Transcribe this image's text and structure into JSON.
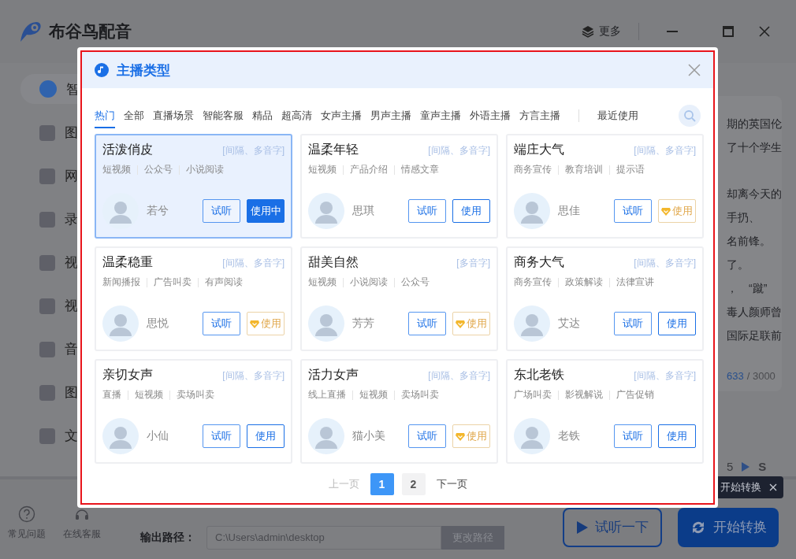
{
  "app": {
    "title": "布谷鸟配音",
    "more": "更多"
  },
  "sidebar": {
    "items": [
      {
        "label": "智",
        "selected": true
      },
      {
        "label": "图",
        "selected": false
      },
      {
        "label": "网",
        "selected": false
      },
      {
        "label": "录",
        "selected": false
      },
      {
        "label": "视",
        "selected": false
      },
      {
        "label": "视",
        "selected": false
      },
      {
        "label": "音",
        "selected": false
      },
      {
        "label": "图",
        "selected": false
      },
      {
        "label": "文",
        "selected": false
      }
    ]
  },
  "editor": {
    "paragraphs": [
      [
        "期的英国伦",
        "了十个学生"
      ],
      [
        "却离今天的",
        "手扔、",
        "名前锋。",
        "了。",
        "，　“蹴”",
        "毒人颜师曾",
        "国际足联前"
      ]
    ],
    "count": "633",
    "limit": "/ 3000",
    "toolbar": [
      "5",
      "S"
    ]
  },
  "footer": {
    "links": [
      "常见问题",
      "在线客服"
    ],
    "output_label": "输出路径：",
    "output_path": "C:\\Users\\admin\\desktop",
    "change_path": "更改路径",
    "preview": "试听一下",
    "start": "开始转换",
    "tooltip": "开始转换"
  },
  "dialog": {
    "title": "主播类型",
    "tabs": [
      {
        "label": "热门",
        "selected": true
      },
      {
        "label": "全部",
        "selected": false
      },
      {
        "label": "直播场景",
        "selected": false
      },
      {
        "label": "智能客服",
        "selected": false
      },
      {
        "label": "精品",
        "selected": false
      },
      {
        "label": "超高清",
        "selected": false
      },
      {
        "label": "女声主播",
        "selected": false
      },
      {
        "label": "男声主播",
        "selected": false
      },
      {
        "label": "童声主播",
        "selected": false
      },
      {
        "label": "外语主播",
        "selected": false
      },
      {
        "label": "方言主播",
        "selected": false
      }
    ],
    "recent": "最近使用",
    "cards": [
      {
        "title": "活泼俏皮",
        "badge": "[间隔、多音字]",
        "tags": [
          "短视频",
          "公众号",
          "小说阅读"
        ],
        "name": "若兮",
        "listen": "试听",
        "use": {
          "label": "使用中",
          "kind": "active"
        },
        "selected": true
      },
      {
        "title": "温柔年轻",
        "badge": "[间隔、多音字]",
        "tags": [
          "短视频",
          "产品介绍",
          "情感文章"
        ],
        "name": "思琪",
        "listen": "试听",
        "use": {
          "label": "使用",
          "kind": "normal"
        },
        "selected": false
      },
      {
        "title": "端庄大气",
        "badge": "[间隔、多音字]",
        "tags": [
          "商务宣传",
          "教育培训",
          "提示语"
        ],
        "name": "思佳",
        "listen": "试听",
        "use": {
          "label": "使用",
          "kind": "vip"
        },
        "selected": false
      },
      {
        "title": "温柔稳重",
        "badge": "[间隔、多音字]",
        "tags": [
          "新闻播报",
          "广告叫卖",
          "有声阅读"
        ],
        "name": "思悦",
        "listen": "试听",
        "use": {
          "label": "使用",
          "kind": "vip"
        },
        "selected": false
      },
      {
        "title": "甜美自然",
        "badge": "[多音字]",
        "tags": [
          "短视频",
          "小说阅读",
          "公众号"
        ],
        "name": "芳芳",
        "listen": "试听",
        "use": {
          "label": "使用",
          "kind": "vip"
        },
        "selected": false
      },
      {
        "title": "商务大气",
        "badge": "[间隔、多音字]",
        "tags": [
          "商务宣传",
          "政策解读",
          "法律宣讲"
        ],
        "name": "艾达",
        "listen": "试听",
        "use": {
          "label": "使用",
          "kind": "normal"
        },
        "selected": false
      },
      {
        "title": "亲切女声",
        "badge": "[间隔、多音字]",
        "tags": [
          "直播",
          "短视频",
          "卖场叫卖"
        ],
        "name": "小仙",
        "listen": "试听",
        "use": {
          "label": "使用",
          "kind": "normal"
        },
        "selected": false
      },
      {
        "title": "活力女声",
        "badge": "[间隔、多音字]",
        "tags": [
          "线上直播",
          "短视频",
          "卖场叫卖"
        ],
        "name": "猫小美",
        "listen": "试听",
        "use": {
          "label": "使用",
          "kind": "vip"
        },
        "selected": false
      },
      {
        "title": "东北老铁",
        "badge": "[间隔、多音字]",
        "tags": [
          "广场叫卖",
          "影视解说",
          "广告促销"
        ],
        "name": "老铁",
        "listen": "试听",
        "use": {
          "label": "使用",
          "kind": "normal"
        },
        "selected": false
      }
    ],
    "pagination": {
      "prev": {
        "label": "上一页",
        "disabled": true
      },
      "pages": [
        {
          "label": "1",
          "selected": true
        },
        {
          "label": "2",
          "selected": false
        }
      ],
      "next": {
        "label": "下一页",
        "disabled": false
      }
    }
  }
}
